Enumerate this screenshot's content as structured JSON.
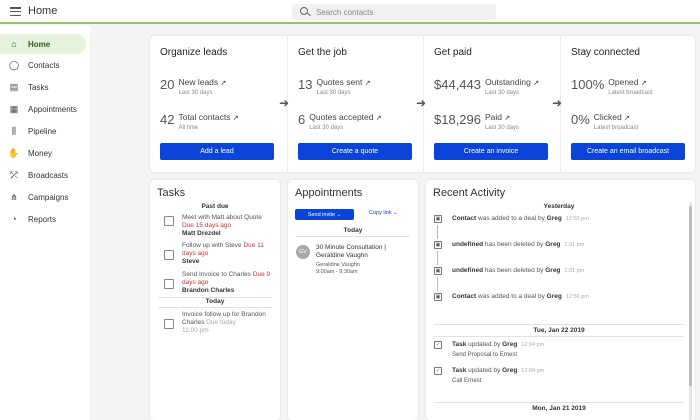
{
  "header": {
    "title": "Home",
    "search_placeholder": "Search contacts"
  },
  "sidebar": {
    "items": [
      {
        "label": "Home",
        "icon": "home-icon",
        "glyph": "⌂",
        "active": true
      },
      {
        "label": "Contacts",
        "icon": "person-icon",
        "glyph": "◯",
        "active": false
      },
      {
        "label": "Tasks",
        "icon": "clipboard-icon",
        "glyph": "▤",
        "active": false
      },
      {
        "label": "Appointments",
        "icon": "calendar-icon",
        "glyph": "▦",
        "active": false
      },
      {
        "label": "Pipeline",
        "icon": "pipeline-icon",
        "glyph": "⫼",
        "active": false
      },
      {
        "label": "Money",
        "icon": "money-icon",
        "glyph": "✋",
        "active": false
      },
      {
        "label": "Broadcasts",
        "icon": "broadcast-icon",
        "glyph": "⤱",
        "active": false
      },
      {
        "label": "Campaigns",
        "icon": "campaign-icon",
        "glyph": "⋔",
        "active": false
      },
      {
        "label": "Reports",
        "icon": "reports-icon",
        "glyph": "◔",
        "active": false
      }
    ]
  },
  "stats": [
    {
      "title": "Organize leads",
      "metrics": [
        {
          "value": "20",
          "label": "New leads",
          "sub": "Last 30 days"
        },
        {
          "value": "42",
          "label": "Total contacts",
          "sub": "All time"
        }
      ],
      "button": "Add a lead"
    },
    {
      "title": "Get the job",
      "metrics": [
        {
          "value": "13",
          "label": "Quotes sent",
          "sub": "Last 30 days"
        },
        {
          "value": "6",
          "label": "Quotes accepted",
          "sub": "Last 30 days"
        }
      ],
      "button": "Create a quote"
    },
    {
      "title": "Get paid",
      "metrics": [
        {
          "value": "$44,443",
          "label": "Outstanding",
          "sub": "Last 30 days"
        },
        {
          "value": "$18,296",
          "label": "Paid",
          "sub": "Last 30 days"
        }
      ],
      "button": "Create an invoice"
    },
    {
      "title": "Stay connected",
      "metrics": [
        {
          "value": "100%",
          "label": "Opened",
          "sub": "Latest broadcast"
        },
        {
          "value": "0%",
          "label": "Clicked",
          "sub": "Latest broadcast"
        }
      ],
      "button": "Create an email broadcast"
    }
  ],
  "tasks": {
    "title": "Tasks",
    "past_due_label": "Past due",
    "today_label": "Today",
    "past_due": [
      {
        "text": "Meet with Matt about Quote",
        "due": "Due 15 days ago",
        "owner": "Matt Drezdel"
      },
      {
        "text": "Follow up with Steve",
        "due": "Due 11 days ago",
        "owner": "Steve"
      },
      {
        "text": "Send Invoice to Charles",
        "due": "Due 9 days ago",
        "owner": "Brandon Charles"
      }
    ],
    "today": [
      {
        "text": "Invoice follow up for Brandon Charles",
        "due": "Due today",
        "time": "11:00 pm"
      }
    ]
  },
  "appointments": {
    "title": "Appointments",
    "send_invite": "Send invite",
    "copy_link": "Copy link",
    "today_label": "Today",
    "items": [
      {
        "initials": "GV",
        "title": "30 Minute Consultation | Geraldine Vaughn",
        "name": "Geraldine Vaughn",
        "time": "9:00am - 9:30am"
      }
    ]
  },
  "activity": {
    "title": "Recent Activity",
    "groups": [
      {
        "date": "Yesterday",
        "items": [
          {
            "subject": "Contact",
            "rest": " was added to a deal by ",
            "by": "Greg",
            "time": "12:50 pm"
          },
          {
            "subject": "undefined",
            "rest": " has been deleted by ",
            "by": "Greg",
            "time": "1:31 pm"
          },
          {
            "subject": "undefined",
            "rest": " has been deleted by ",
            "by": "Greg",
            "time": "1:31 pm"
          },
          {
            "subject": "Contact",
            "rest": " was added to a deal by ",
            "by": "Greg",
            "time": "12:56 pm"
          }
        ]
      },
      {
        "date": "Tue, Jan 22 2019",
        "items": [
          {
            "subject": "Task",
            "rest": " updated by ",
            "by": "Greg",
            "time": "12:04 pm",
            "sub": "Send Proposal to Ernest"
          },
          {
            "subject": "Task",
            "rest": " updated by ",
            "by": "Greg",
            "time": "12:04 pm",
            "sub": "Call Ernest"
          }
        ]
      },
      {
        "date": "Mon, Jan 21 2019",
        "items": []
      }
    ]
  }
}
